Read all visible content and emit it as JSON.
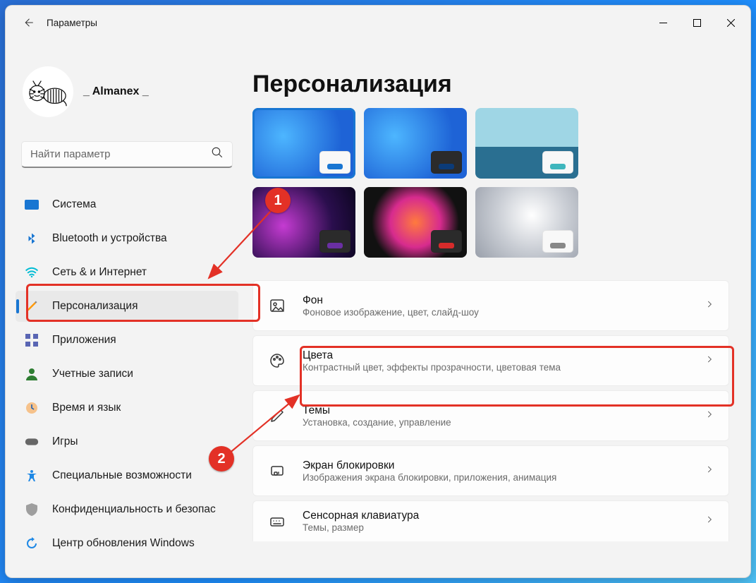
{
  "appTitle": "Параметры",
  "user": {
    "name": "_ Almanex _"
  },
  "search": {
    "placeholder": "Найти параметр"
  },
  "nav": {
    "items": [
      {
        "label": "Система"
      },
      {
        "label": "Bluetooth и устройства"
      },
      {
        "label": "Сеть & и Интернет"
      },
      {
        "label": "Персонализация"
      },
      {
        "label": "Приложения"
      },
      {
        "label": "Учетные записи"
      },
      {
        "label": "Время и язык"
      },
      {
        "label": "Игры"
      },
      {
        "label": "Специальные возможности"
      },
      {
        "label": "Конфиденциальность и безопас"
      },
      {
        "label": "Центр обновления Windows"
      }
    ]
  },
  "page": {
    "title": "Персонализация"
  },
  "themes": [
    {
      "accent": "#1976d2",
      "preview": "light",
      "bg": "radial-gradient(circle at 30% 40%, #4db6ff 0%, #1e63d6 70%)"
    },
    {
      "accent": "#0b3b78",
      "preview": "dark",
      "bg": "radial-gradient(circle at 30% 40%, #4db6ff 0%, #1e63d6 70%)"
    },
    {
      "accent": "#3fb6bd",
      "preview": "light",
      "bg": "linear-gradient(#9fd6e5 0%, #9fd6e5 55%, #2a6f91 55%, #2a6f91 100%)"
    },
    {
      "accent": "#6a2fa3",
      "preview": "dark",
      "bg": "radial-gradient(circle at 30% 55%, #c53bd2 0%, #2a0e4d 60%, #0c0520 100%)"
    },
    {
      "accent": "#d72b2b",
      "preview": "dark",
      "bg": "radial-gradient(circle at 50% 50%, #ff7a3d 0%, #d72b8e 40%, #111 70%)"
    },
    {
      "accent": "#888888",
      "preview": "light",
      "bg": "radial-gradient(circle at 55% 40%, #fff 0%, #c9cdd4 50%, #9aa0ab 100%)"
    }
  ],
  "options": [
    {
      "title": "Фон",
      "sub": "Фоновое изображение, цвет, слайд-шоу",
      "icon": "image"
    },
    {
      "title": "Цвета",
      "sub": "Контрастный цвет, эффекты прозрачности, цветовая тема",
      "icon": "palette"
    },
    {
      "title": "Темы",
      "sub": "Установка, создание, управление",
      "icon": "pen"
    },
    {
      "title": "Экран блокировки",
      "sub": "Изображения экрана блокировки, приложения, анимация",
      "icon": "lock"
    },
    {
      "title": "Сенсорная клавиатура",
      "sub": "Темы, размер",
      "icon": "keyboard"
    }
  ],
  "annotations": {
    "badge1": "1",
    "badge2": "2"
  }
}
